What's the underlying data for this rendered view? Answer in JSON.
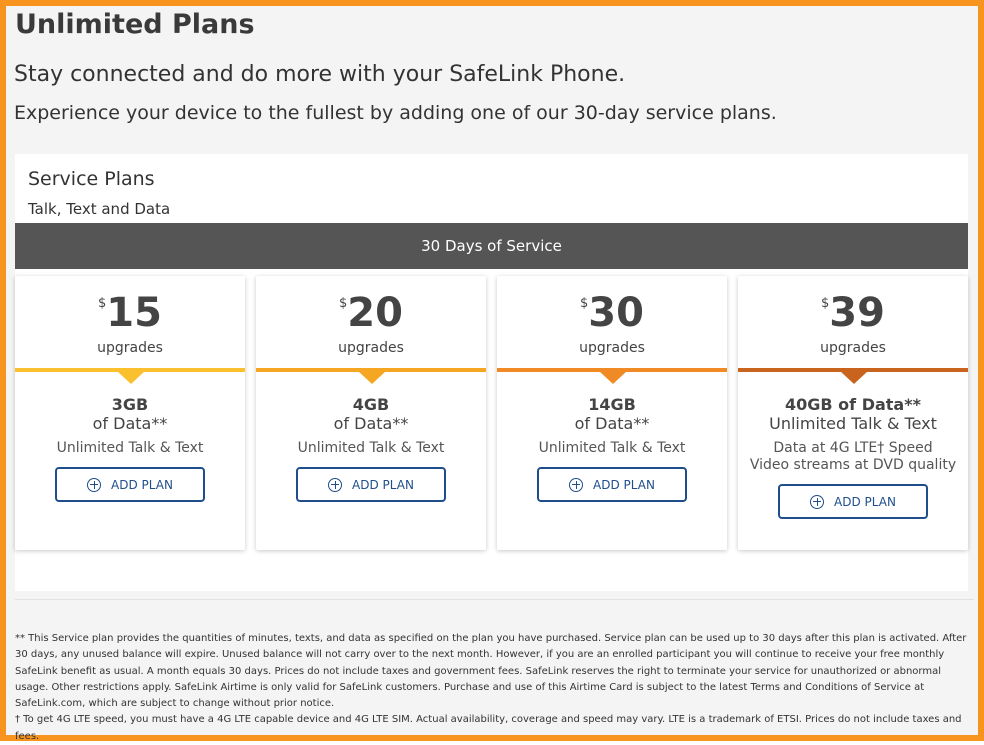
{
  "page": {
    "title": "Unlimited Plans",
    "subtitle": "Stay connected and do more with your SafeLink Phone.",
    "subtitle2": "Experience your device to the fullest by adding one of our 30-day service plans."
  },
  "panel": {
    "title": "Service Plans",
    "subtitle": "Talk, Text and Data",
    "service_bar": "30 Days of Service"
  },
  "plans": [
    {
      "currency": "$",
      "price": "15",
      "upgrades": "upgrades",
      "data": "3GB",
      "data_of": "of Data**",
      "talk": "Unlimited Talk & Text",
      "button": "ADD PLAN",
      "accent": "#fbc02d"
    },
    {
      "currency": "$",
      "price": "20",
      "upgrades": "upgrades",
      "data": "4GB",
      "data_of": "of Data**",
      "talk": "Unlimited Talk & Text",
      "button": "ADD PLAN",
      "accent": "#f5a623"
    },
    {
      "currency": "$",
      "price": "30",
      "upgrades": "upgrades",
      "data": "14GB",
      "data_of": "of Data**",
      "talk": "Unlimited Talk & Text",
      "button": "ADD PLAN",
      "accent": "#f08a24"
    },
    {
      "currency": "$",
      "price": "39",
      "upgrades": "upgrades",
      "line1": "40GB of Data**",
      "line2": "Unlimited Talk & Text",
      "line3": "Data at 4G LTE† Speed",
      "line4": "Video streams at DVD quality",
      "button": "ADD PLAN",
      "accent": "#c8641e"
    }
  ],
  "footnotes": {
    "note1": "** This Service plan provides the quantities of minutes, texts, and data as specified on the plan you have purchased. Service plan can be used up to 30 days after this plan is activated. After 30 days, any unused balance will expire. Unused balance will not carry over to the next month. However, if you are an enrolled participant you will continue to receive your free monthly SafeLink benefit as usual. A month equals 30 days. Prices do not include taxes and government fees. SafeLink reserves the right to terminate your service for unauthorized or abnormal usage. Other restrictions apply. SafeLink Airtime is only valid for SafeLink customers. Purchase and use of this Airtime Card is subject to the latest Terms and Conditions of Service at SafeLink.com, which are subject to change without prior notice.",
    "note2": "† To get 4G LTE speed, you must have a 4G LTE capable device and 4G LTE SIM. Actual availability, coverage and speed may vary. LTE is a trademark of ETSI. Prices do not include taxes and fees."
  },
  "colors": {
    "frame": "#f7941d",
    "button": "#1f4e8c",
    "service_bar": "#555555"
  }
}
